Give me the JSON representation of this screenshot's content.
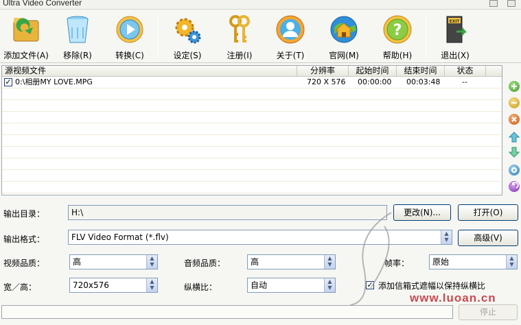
{
  "window": {
    "title": "Ultra Video Converter"
  },
  "toolbar": {
    "add_file": "添加文件(A)",
    "remove": "移除(R)",
    "convert": "转换(C)",
    "settings": "设定(S)",
    "register": "注册(I)",
    "about": "关于(T)",
    "website": "官网(M)",
    "help": "帮助(H)",
    "exit": "退出(X)"
  },
  "filelist": {
    "columns": [
      "源视频文件",
      "分辨率",
      "起始时间",
      "结束时间",
      "状态"
    ],
    "rows": [
      {
        "checked": true,
        "file": "0:\\相册MY LOVE.MPG",
        "resolution": "720 X 576",
        "start": "00:00:00",
        "end": "00:03:48",
        "status": "--"
      }
    ]
  },
  "output": {
    "dir_label": "输出目录：",
    "dir_value": "H:\\",
    "change_button": "更改(N)...",
    "open_button": "打开(O)",
    "format_label": "输出格式：",
    "format_value": "FLV Video Format (*.flv)",
    "advanced_button": "高级(V)"
  },
  "options": {
    "video_quality_label": "视频品质：",
    "video_quality_value": "高",
    "audio_quality_label": "音频品质：",
    "audio_quality_value": "高",
    "framerate_label": "帧率：",
    "framerate_value": "原始",
    "size_label": "宽／高：",
    "size_value": "720x576",
    "aspect_label": "纵横比：",
    "aspect_value": "自动",
    "letterbox_label": "添加信箱式遮幅以保持纵横比",
    "letterbox_checked": true
  },
  "stop_button": "停止",
  "watermark": {
    "site": "www.luoan.cn"
  },
  "colors": {
    "accent": "#003c74",
    "field_border": "#7f9db9"
  }
}
